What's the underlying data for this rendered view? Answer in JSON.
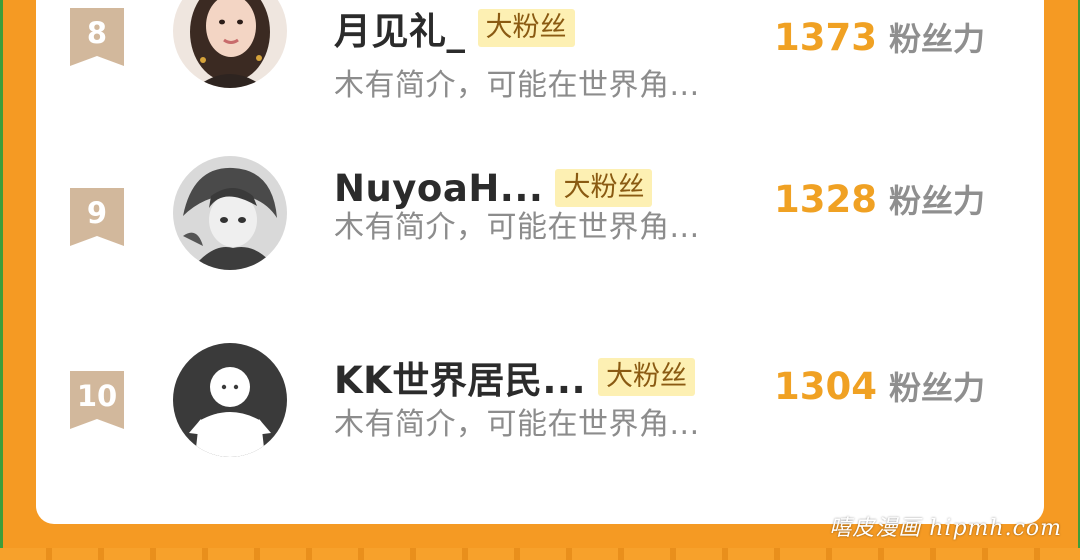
{
  "colors": {
    "background": "#f59a23",
    "card": "#ffffff",
    "rank_badge": "#d2b89c",
    "score": "#f0a123",
    "fan_badge_bg": "#fdf0b3"
  },
  "rows": [
    {
      "rank": "8",
      "name": "月见礼_",
      "badge": "大粉丝",
      "bio": "木有简介，可能在世界角...",
      "score": "1373",
      "unit": "粉丝力",
      "avatar": "photo-avatar"
    },
    {
      "rank": "9",
      "name": "NuyoaH...",
      "badge": "大粉丝",
      "bio": "木有简介，可能在世界角...",
      "score": "1328",
      "unit": "粉丝力",
      "avatar": "anime-avatar"
    },
    {
      "rank": "10",
      "name": "KK世界居民...",
      "badge": "大粉丝",
      "bio": "木有简介，可能在世界角...",
      "score": "1304",
      "unit": "粉丝力",
      "avatar": "default-avatar"
    }
  ],
  "watermark": "嘻皮漫画 hipmh.com"
}
